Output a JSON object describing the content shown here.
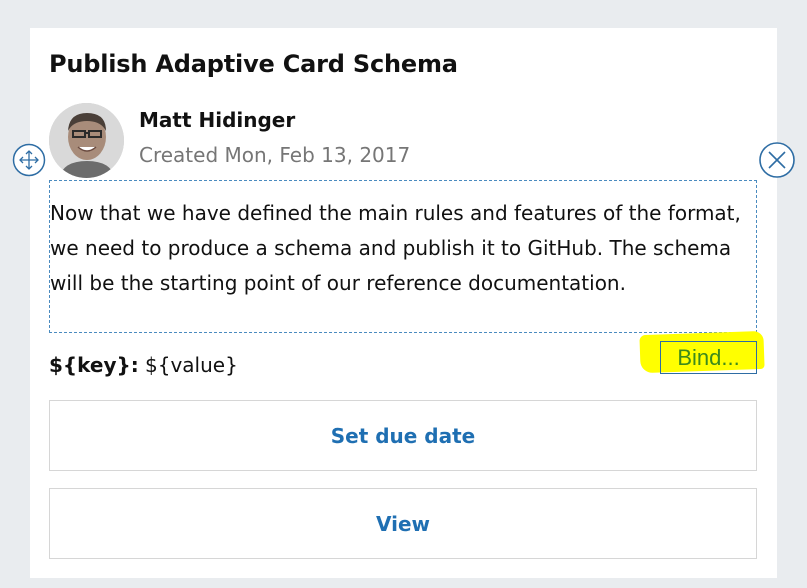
{
  "card": {
    "title": "Publish Adaptive Card Schema",
    "author": {
      "name": "Matt Hidinger",
      "created": "Created Mon, Feb 13, 2017"
    },
    "body": "Now that we have defined the main rules and features of the format, we need to produce a schema and publish it to GitHub. The schema will be the starting point of our reference documentation.",
    "fact": {
      "key": "${key}:",
      "value": "${value}"
    },
    "bind_label": "Bind...",
    "actions": [
      {
        "label": "Set due date"
      },
      {
        "label": "View"
      }
    ]
  },
  "colors": {
    "background": "#e9ecef",
    "card": "#ffffff",
    "action_text": "#1f6fb2",
    "selection_border": "#4a8bbf",
    "highlight": "#ffff00",
    "bind_text": "#3c8a1c",
    "muted_text": "#767676"
  },
  "icons": {
    "move": "move-arrows-icon",
    "close": "close-icon",
    "avatar": "profile-photo"
  }
}
